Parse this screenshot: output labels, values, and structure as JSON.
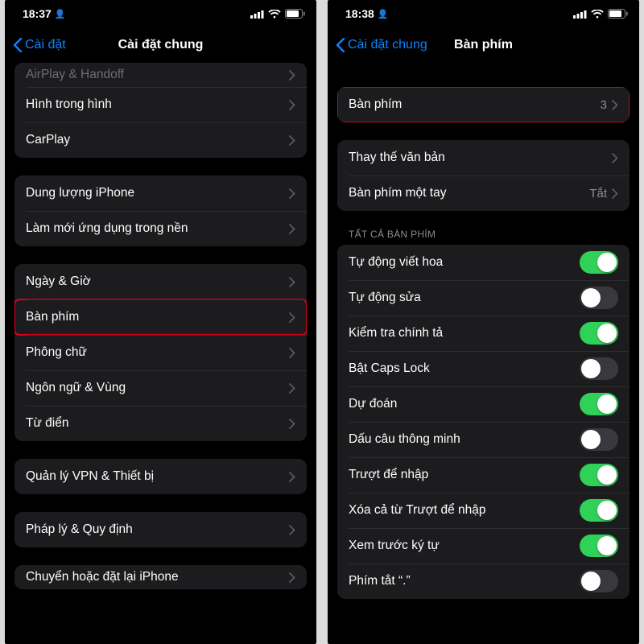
{
  "left": {
    "status": {
      "time": "18:37"
    },
    "nav": {
      "back": "Cài đặt",
      "title": "Cài đặt chung"
    },
    "groups": [
      {
        "partial": true,
        "rows": [
          {
            "label": "AirPlay & Handoff",
            "half": true
          },
          {
            "label": "Hình trong hình"
          },
          {
            "label": "CarPlay"
          }
        ]
      },
      {
        "rows": [
          {
            "label": "Dung lượng iPhone"
          },
          {
            "label": "Làm mới ứng dụng trong nền"
          }
        ]
      },
      {
        "rows": [
          {
            "label": "Ngày & Giờ"
          },
          {
            "label": "Bàn phím",
            "highlight": true
          },
          {
            "label": "Phông chữ"
          },
          {
            "label": "Ngôn ngữ & Vùng"
          },
          {
            "label": "Từ điển"
          }
        ]
      },
      {
        "rows": [
          {
            "label": "Quản lý VPN & Thiết bị"
          }
        ]
      },
      {
        "rows": [
          {
            "label": "Pháp lý & Quy định"
          }
        ]
      },
      {
        "rows": [
          {
            "label": "Chuyển hoặc đặt lại iPhone",
            "half": true
          }
        ]
      }
    ]
  },
  "right": {
    "status": {
      "time": "18:38"
    },
    "nav": {
      "back": "Cài đặt chung",
      "title": "Bàn phím"
    },
    "group1": {
      "rows": [
        {
          "label": "Bàn phím",
          "value": "3",
          "highlight": true
        }
      ]
    },
    "group2": {
      "rows": [
        {
          "label": "Thay thế văn bản"
        },
        {
          "label": "Bàn phím một tay",
          "value": "Tắt"
        }
      ]
    },
    "section_header": "TẤT CẢ BÀN PHÍM",
    "toggles": [
      {
        "label": "Tự động viết hoa",
        "on": true
      },
      {
        "label": "Tự động sửa",
        "on": false
      },
      {
        "label": "Kiểm tra chính tả",
        "on": true
      },
      {
        "label": "Bật Caps Lock",
        "on": false
      },
      {
        "label": "Dự đoán",
        "on": true
      },
      {
        "label": "Dấu câu thông minh",
        "on": false
      },
      {
        "label": "Trượt để nhập",
        "on": true
      },
      {
        "label": "Xóa cả từ Trượt để nhập",
        "on": true
      },
      {
        "label": "Xem trước ký tự",
        "on": true
      },
      {
        "label": "Phím tắt “.”",
        "on": false
      }
    ]
  }
}
